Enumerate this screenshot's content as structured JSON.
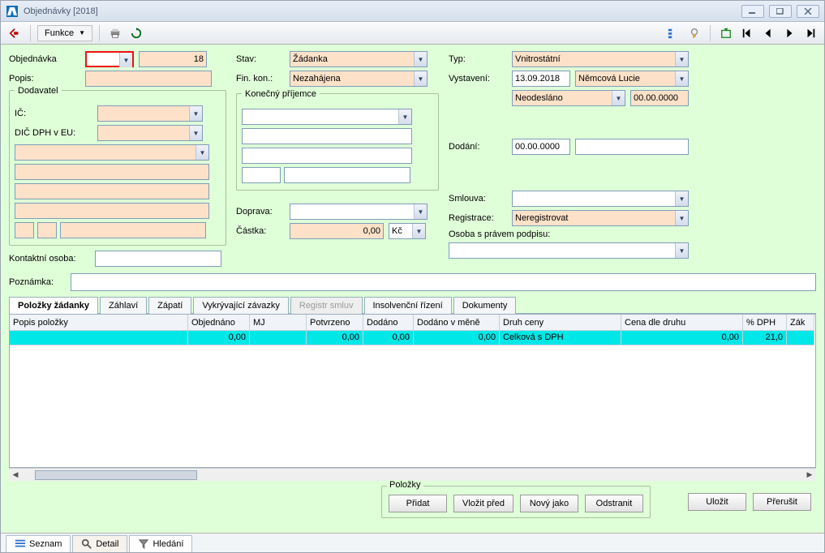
{
  "window": {
    "title": "Objednávky [2018]"
  },
  "toolbar": {
    "funkce_label": "Funkce"
  },
  "labels": {
    "objednavka": "Objednávka",
    "popis": "Popis:",
    "dodavatel": "Dodavatel",
    "ic": "IČ:",
    "dic": "DIČ DPH v EU:",
    "kontaktni": "Kontaktní osoba:",
    "poznamka": "Poznámka:",
    "stav": "Stav:",
    "finkon": "Fin. kon.:",
    "konecny": "Konečný příjemce",
    "doprava": "Doprava:",
    "castka": "Částka:",
    "typ": "Typ:",
    "vystaveni": "Vystavení:",
    "dodani": "Dodání:",
    "smlouva": "Smlouva:",
    "registrace": "Registrace:",
    "osoba_podpis": "Osoba s právem podpisu:"
  },
  "values": {
    "obj_num": "18",
    "stav": "Žádanka",
    "finkon": "Nezahájena",
    "typ": "Vnitrostátní",
    "vystaveni_date": "13.09.2018",
    "vystaveni_person": "Němcová Lucie",
    "odeslano": "Neodesláno",
    "odeslano_date": "00.00.0000",
    "dodani_date": "00.00.0000",
    "registrace": "Neregistrovat",
    "castka": "0,00",
    "castka_cur": "Kč"
  },
  "tabs": {
    "polozky": "Položky žádanky",
    "zahlavi": "Záhlaví",
    "zapati": "Zápatí",
    "vykryvajici": "Vykrývající závazky",
    "registr": "Registr smluv",
    "insolvencni": "Insolvenční řízení",
    "dokumenty": "Dokumenty"
  },
  "grid": {
    "headers": {
      "popis": "Popis položky",
      "objednano": "Objednáno",
      "mj": "MJ",
      "potvrzeno": "Potvrzeno",
      "dodano": "Dodáno",
      "dodano_mene": "Dodáno v měně",
      "druh_ceny": "Druh ceny",
      "cena_druhu": "Cena dle druhu",
      "pct_dph": "% DPH",
      "zak": "Zák"
    },
    "row": {
      "popis": "",
      "objednano": "0,00",
      "mj": "",
      "potvrzeno": "0,00",
      "dodano": "0,00",
      "dodano_mene": "0,00",
      "druh_ceny": "Celková s DPH",
      "cena_druhu": "0,00",
      "pct_dph": "21,0",
      "zak": ""
    }
  },
  "buttons": {
    "polozky_legend": "Položky",
    "pridat": "Přidat",
    "vlozit_pred": "Vložit před",
    "novy_jako": "Nový jako",
    "odstranit": "Odstranit",
    "ulozit": "Uložit",
    "prerusit": "Přerušit"
  },
  "footer": {
    "seznam": "Seznam",
    "detail": "Detail",
    "hledani": "Hledání"
  }
}
